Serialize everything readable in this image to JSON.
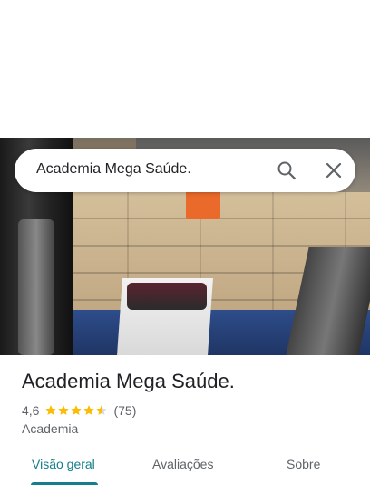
{
  "search": {
    "query": "Academia Mega Saúde."
  },
  "place": {
    "name": "Academia Mega Saúde.",
    "rating": "4,6",
    "stars": 4.6,
    "review_count": "(75)",
    "category": "Academia"
  },
  "tabs": [
    {
      "label": "Visão geral",
      "active": true
    },
    {
      "label": "Avaliações",
      "active": false
    },
    {
      "label": "Sobre",
      "active": false
    }
  ],
  "colors": {
    "accent": "#137e8c",
    "star": "#fbbc04",
    "text_primary": "#202124",
    "text_secondary": "#5f6368"
  },
  "icons": {
    "search": "search-icon",
    "close": "close-icon",
    "star": "star-icon"
  }
}
